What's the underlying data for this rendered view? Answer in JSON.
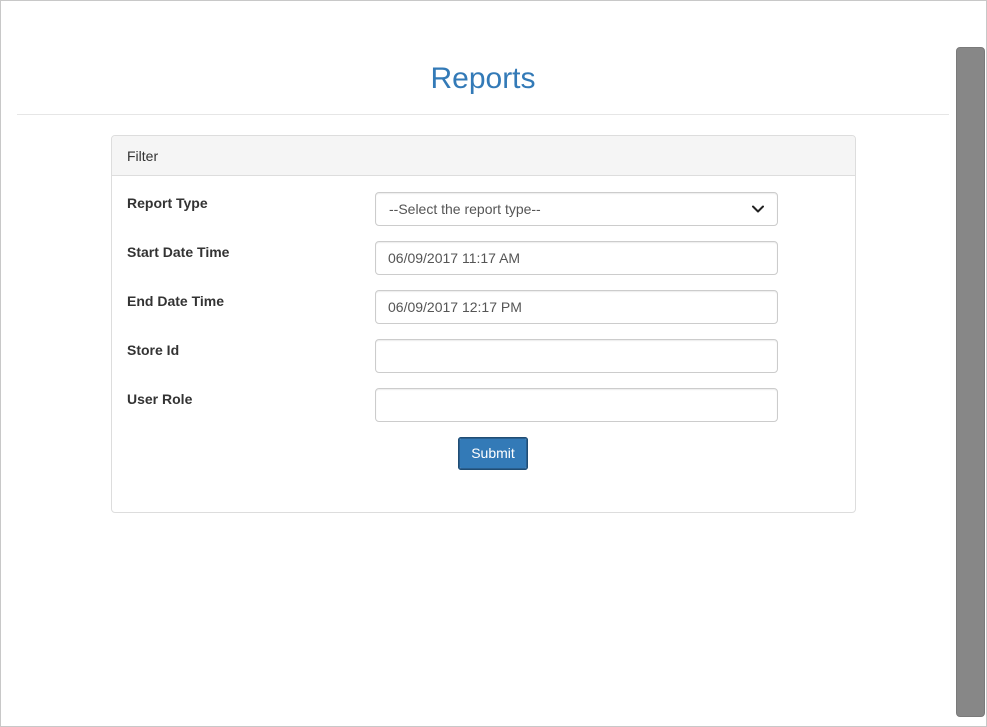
{
  "page": {
    "title": "Reports"
  },
  "filter_panel": {
    "heading": "Filter",
    "fields": [
      {
        "label": "Report Type",
        "type": "select",
        "value": "--Select the report type--",
        "icon": "chevron-down-icon"
      },
      {
        "label": "Start Date Time",
        "type": "text",
        "value": "06/09/2017 11:17 AM"
      },
      {
        "label": "End Date Time",
        "type": "text",
        "value": "06/09/2017 12:17 PM"
      },
      {
        "label": "Store Id",
        "type": "text",
        "value": ""
      },
      {
        "label": "User Role",
        "type": "text",
        "value": ""
      }
    ],
    "submit_label": "Submit"
  },
  "colors": {
    "accent": "#337ab7",
    "scrollbar_thumb": "#878787"
  }
}
